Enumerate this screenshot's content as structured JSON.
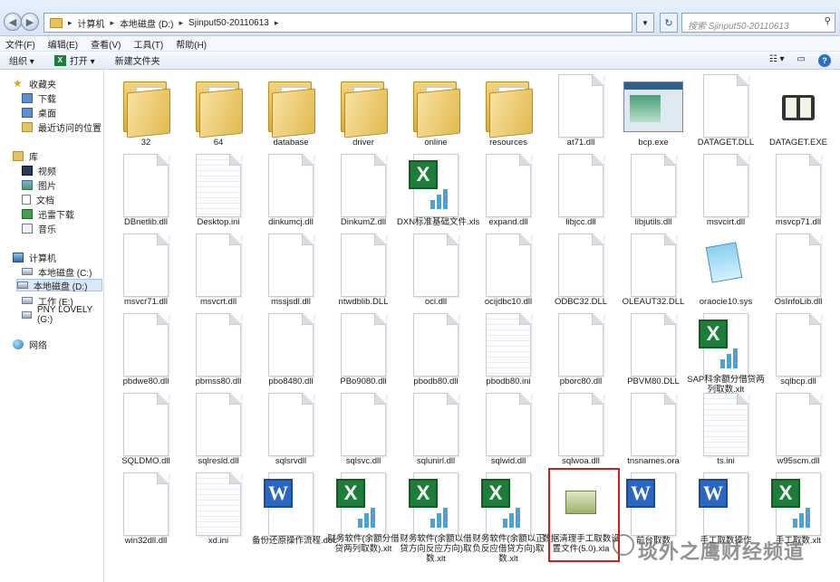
{
  "address": {
    "crumbs": [
      "计算机",
      "本地磁盘 (D:)",
      "Sjinput50-20110613"
    ],
    "search_placeholder": "搜索 Sjinput50-20110613"
  },
  "menu": [
    "文件(F)",
    "编辑(E)",
    "查看(V)",
    "工具(T)",
    "帮助(H)"
  ],
  "toolbar": {
    "organize": "组织 ▾",
    "open": "打开 ▾",
    "new_folder": "新建文件夹"
  },
  "sidebar": {
    "favorites": "收藏夹",
    "fav_items": [
      "下载",
      "桌面",
      "最近访问的位置"
    ],
    "libraries": "库",
    "lib_items": [
      "视频",
      "图片",
      "文档",
      "迅雷下载",
      "音乐"
    ],
    "computer": "计算机",
    "drives": [
      "本地磁盘 (C:)",
      "本地磁盘 (D:)",
      "工作 (E:)",
      "PNY LOVELY (G:)"
    ],
    "network": "网络"
  },
  "files": [
    {
      "name": "32",
      "type": "folder"
    },
    {
      "name": "64",
      "type": "folder"
    },
    {
      "name": "database",
      "type": "folder"
    },
    {
      "name": "driver",
      "type": "folder"
    },
    {
      "name": "online",
      "type": "folder"
    },
    {
      "name": "resources",
      "type": "folder"
    },
    {
      "name": "at71.dll",
      "type": "dll"
    },
    {
      "name": "bcp.exe",
      "type": "window"
    },
    {
      "name": "DATAGET.DLL",
      "type": "dll"
    },
    {
      "name": "DATAGET.EXE",
      "type": "book"
    },
    {
      "name": "DBnetlib.dll",
      "type": "dll"
    },
    {
      "name": "Desktop.ini",
      "type": "ini"
    },
    {
      "name": "dinkumcj.dll",
      "type": "dll"
    },
    {
      "name": "DinkumZ.dll",
      "type": "dll"
    },
    {
      "name": "DXN标准基础文件.xls",
      "type": "xls"
    },
    {
      "name": "expand.dll",
      "type": "dll"
    },
    {
      "name": "libjcc.dll",
      "type": "dll"
    },
    {
      "name": "libjutils.dll",
      "type": "dll"
    },
    {
      "name": "msvcirt.dll",
      "type": "dll"
    },
    {
      "name": "msvcp71.dll",
      "type": "dll"
    },
    {
      "name": "msvcr71.dll",
      "type": "dll"
    },
    {
      "name": "msvcrt.dll",
      "type": "dll"
    },
    {
      "name": "mssjsdl.dll",
      "type": "dll"
    },
    {
      "name": "ntwdblib.DLL",
      "type": "dll"
    },
    {
      "name": "oci.dll",
      "type": "dll"
    },
    {
      "name": "ocijdbc10.dll",
      "type": "dll"
    },
    {
      "name": "ODBC32.DLL",
      "type": "dll"
    },
    {
      "name": "OLEAUT32.DLL",
      "type": "dll"
    },
    {
      "name": "oraocie10.sys",
      "type": "notepad"
    },
    {
      "name": "OsInfoLib.dll",
      "type": "dll"
    },
    {
      "name": "pbdwe80.dll",
      "type": "dll"
    },
    {
      "name": "pbmss80.dll",
      "type": "dll"
    },
    {
      "name": "pbo8480.dll",
      "type": "dll"
    },
    {
      "name": "PBo9080.dll",
      "type": "dll"
    },
    {
      "name": "pbodb80.dll",
      "type": "dll"
    },
    {
      "name": "pbodb80.ini",
      "type": "ini"
    },
    {
      "name": "pborc80.dll",
      "type": "dll"
    },
    {
      "name": "PBVM80.DLL",
      "type": "dll"
    },
    {
      "name": "SAP科余额分借贷两列取数.xlt",
      "type": "xls"
    },
    {
      "name": "sqlbcp.dll",
      "type": "dll"
    },
    {
      "name": "SQLDMO.dll",
      "type": "dll"
    },
    {
      "name": "sqlresld.dll",
      "type": "dll"
    },
    {
      "name": "sqlsrvdll",
      "type": "dll"
    },
    {
      "name": "sqlsvc.dll",
      "type": "dll"
    },
    {
      "name": "sqlunirl.dll",
      "type": "dll"
    },
    {
      "name": "sqlwid.dll",
      "type": "dll"
    },
    {
      "name": "sqlwoa.dll",
      "type": "dll"
    },
    {
      "name": "tnsnames.ora",
      "type": "dll"
    },
    {
      "name": "ts.ini",
      "type": "ini"
    },
    {
      "name": "w95scm.dll",
      "type": "dll"
    },
    {
      "name": "win32dll.dll",
      "type": "dll"
    },
    {
      "name": "xd.ini",
      "type": "ini"
    },
    {
      "name": "备份还原操作流程.doc",
      "type": "doc"
    },
    {
      "name": "财务软件(余额分借贷两列取数).xlt",
      "type": "xls"
    },
    {
      "name": "财务软件(余额以借贷方向反应方向)取数.xlt",
      "type": "xls"
    },
    {
      "name": "财务软件(余额以正负反应借贷方向)取数.xlt",
      "type": "xls"
    },
    {
      "name": "数据清理手工取数设置文件(5.0).xla",
      "type": "pkg"
    },
    {
      "name": "前台取数",
      "type": "doc"
    },
    {
      "name": "手工取数操作",
      "type": "doc"
    },
    {
      "name": "手工取数.xlt",
      "type": "xls"
    }
  ],
  "watermark": "琰外之鹰财经频道"
}
